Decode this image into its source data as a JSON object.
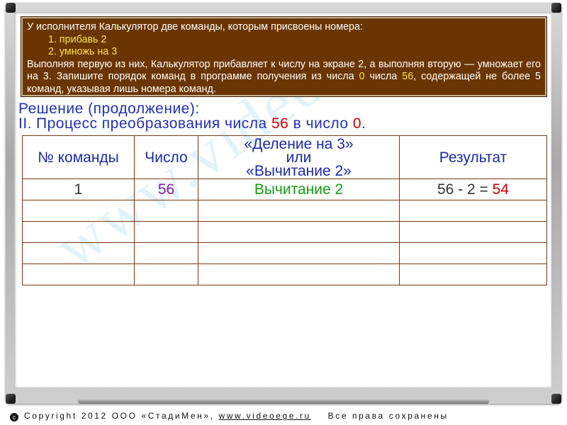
{
  "task": {
    "line1": "У исполнителя Калькулятор две команды, которым присвоены номера:",
    "command1": "1. прибавь 2",
    "command2": "2. умножь на 3",
    "para_part1": "Выполняя первую из них, Калькулятор прибавляет к числу на экране 2, а выполняя вторую — умножает его на 3. Запишите порядок команд в программе получения из числа ",
    "start_number": "0",
    "para_part2": " числа ",
    "target_number": "56",
    "para_part3": ", содержащей не более 5 команд, указывая лишь номера команд."
  },
  "solution": {
    "title": "Решение (продолжение):",
    "step_label": "II.",
    "process_text_1": "Процесс преобразования числа ",
    "from_number": "56",
    "process_text_2": " в число ",
    "to_number": "0",
    "process_text_3": "."
  },
  "table": {
    "headers": {
      "command_no": "№ команды",
      "number": "Число",
      "operation_line1": "«Деление на 3»",
      "operation_line2": "или",
      "operation_line3": "«Вычитание 2»",
      "result": "Результат"
    },
    "rows": [
      {
        "command_no": "1",
        "number": "56",
        "operation": "Вычитание 2",
        "result_expr": "56 - 2 = ",
        "result_value": "54"
      },
      {
        "command_no": "",
        "number": "",
        "operation": "",
        "result_expr": "",
        "result_value": ""
      },
      {
        "command_no": "",
        "number": "",
        "operation": "",
        "result_expr": "",
        "result_value": ""
      },
      {
        "command_no": "",
        "number": "",
        "operation": "",
        "result_expr": "",
        "result_value": ""
      },
      {
        "command_no": "",
        "number": "",
        "operation": "",
        "result_expr": "",
        "result_value": ""
      }
    ]
  },
  "footer": {
    "symbol": "c",
    "copyright": "Copyright 2012 ООО «СтадиМен», ",
    "site": "www.videoege.ru",
    "rights": "    Все права сохранены"
  },
  "colors": {
    "task_background": "#6a3500",
    "task_highlight": "#ffe14a",
    "heading_blue": "#2030b0",
    "accent_red": "#cc0000",
    "operation_green": "#169b16",
    "number_purple": "#8a1aa0"
  }
}
